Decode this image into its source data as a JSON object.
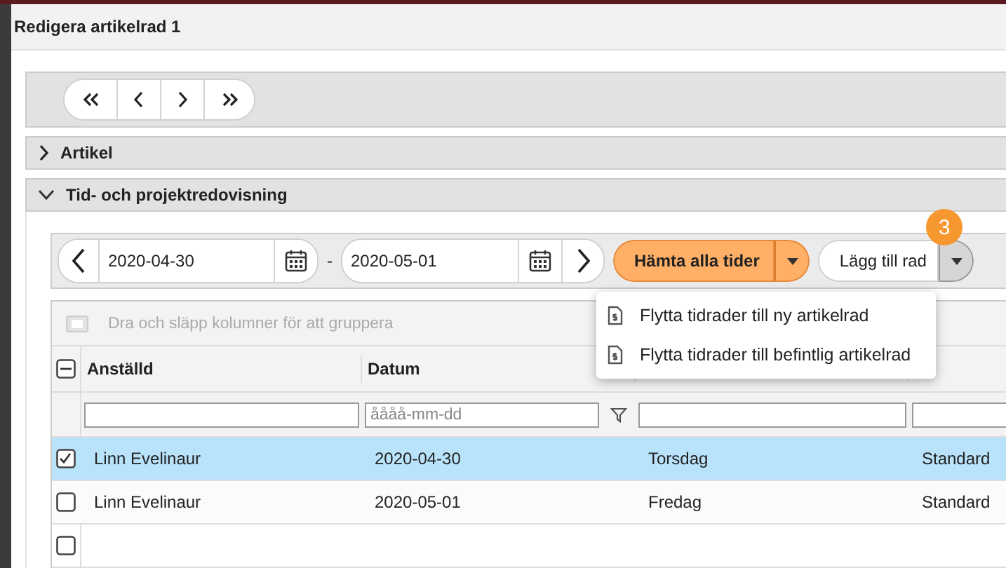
{
  "window": {
    "title": "Redigera artikelrad 1"
  },
  "sections": [
    {
      "label": "Artikel",
      "expanded": false
    },
    {
      "label": "Tid- och projektredovisning",
      "expanded": true
    }
  ],
  "toolbar": {
    "from_date": "2020-04-30",
    "separator": "-",
    "to_date": "2020-05-01",
    "fetch_button": "Hämta alla tider",
    "add_button": "Lägg till rad"
  },
  "badge": "3",
  "menu": {
    "items": [
      "Flytta tidrader till ny artikelrad",
      "Flytta tidrader till befintlig artikelrad"
    ]
  },
  "grid": {
    "group_hint": "Dra och släpp kolumner för att gruppera",
    "all_selected": false,
    "some_selected": true,
    "columns": [
      {
        "label": "Anställd",
        "kind": "text"
      },
      {
        "label": "Datum",
        "kind": "date",
        "placeholder": "åååå-mm-dd"
      },
      {
        "kind": "text"
      },
      {
        "kind": "text"
      }
    ],
    "rows": [
      {
        "kind": "data",
        "selected": true,
        "cells": [
          "Linn Evelinaur",
          "2020-04-30",
          "Torsdag",
          "Standard"
        ]
      },
      {
        "kind": "data",
        "selected": false,
        "cells": [
          "Linn Evelinaur",
          "2020-05-01",
          "Fredag",
          "Standard"
        ]
      },
      {
        "kind": "new",
        "selected": false
      }
    ]
  }
}
